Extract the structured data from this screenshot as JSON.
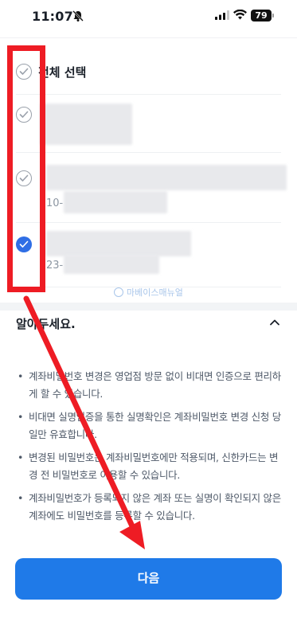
{
  "status_bar": {
    "time": "11:07",
    "battery": "79",
    "icons": [
      "bell-slash-icon",
      "signal-icon",
      "wifi-icon",
      "battery-icon"
    ]
  },
  "select_all": {
    "label": "전체 선택",
    "checked": false
  },
  "accounts": [
    {
      "checked": false,
      "number": ""
    },
    {
      "checked": false,
      "number": "10-"
    },
    {
      "checked": true,
      "number": "23-"
    }
  ],
  "watermark": "마베이스매뉴얼",
  "notice": {
    "title": "알아두세요.",
    "items": [
      "계좌비밀번호 변경은 영업점 방문 없이 비대면 인증으로 편리하게 할 수 있습니다.",
      "비대면 실명인증을 통한 실명확인은 계좌비밀번호 변경 신청 당일만 유효합니다.",
      "변경된 비밀번호는 계좌비밀번호에만 적용되며, 신한카드는 변경 전 비밀번호로 이용할 수 있습니다.",
      "계좌비밀번호가 등록되지 않은 계좌 또는 실명이 확인되지 않은 계좌에도 비밀번호를 등록할 수 있습니다."
    ]
  },
  "next_button": {
    "label": "다음"
  },
  "colors": {
    "primary": "#1f7ae8",
    "check_active": "#2f6ee5",
    "annotation": "#ee1c24"
  }
}
